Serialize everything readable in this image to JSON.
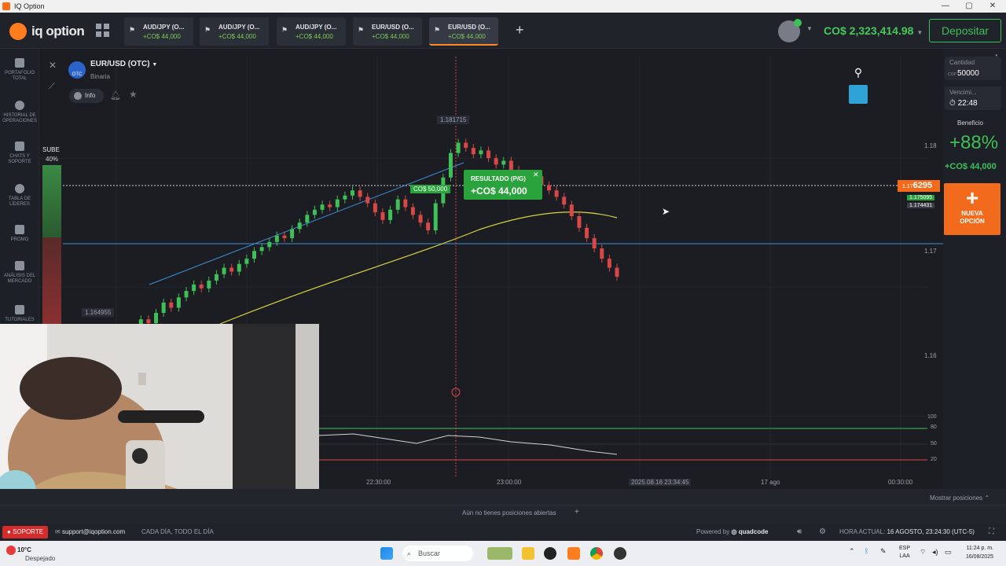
{
  "window": {
    "title": "IQ Option"
  },
  "brand": {
    "name": "iq option"
  },
  "tabs": [
    {
      "name": "AUD/JPY (O...",
      "profit": "+CO$ 44,000"
    },
    {
      "name": "AUD/JPY (O...",
      "profit": "+CO$ 44,000"
    },
    {
      "name": "AUD/JPY (O...",
      "profit": "+CO$ 44,000"
    },
    {
      "name": "EUR/USD (O...",
      "profit": "+CO$ 44,000"
    },
    {
      "name": "EUR/USD (O...",
      "profit": "+CO$ 44,000"
    }
  ],
  "account": {
    "balance": "CO$ 2,323,414.98",
    "deposit_label": "Depositar"
  },
  "nav": [
    {
      "label": "PORTAFOLIO TOTAL"
    },
    {
      "label": "HISTORIAL DE OPERACIONES"
    },
    {
      "label": "CHATS Y SOPORTE"
    },
    {
      "label": "TABLA DE LÍDERES"
    },
    {
      "label": "PROMO"
    },
    {
      "label": "ANÁLISIS DEL MERCADO"
    },
    {
      "label": "TUTORIALES"
    }
  ],
  "asset": {
    "name": "EUR/USD (OTC)",
    "type": "Binaria",
    "info_label": "Info",
    "badge": "OTC"
  },
  "sentiment": {
    "label": "SUBE",
    "value": "40%"
  },
  "chart_labels": {
    "top_price": "1.181715",
    "low_price": "1.164955",
    "current_price_prefix": "1.17",
    "current_price_big": "6295",
    "price_a": "1.175095",
    "price_b": "1.174431",
    "invest_tag": "CO$ 50,000",
    "result_title": "RESULTADO (P/G)",
    "result_value": "+CO$ 44,000",
    "y_ticks": [
      "1.18",
      "1.17",
      "1.16"
    ],
    "osc_ticks": [
      "100",
      "80",
      "50",
      "20"
    ],
    "x_ticks": [
      "22:30:00",
      "23:00:00",
      "2025.08.16 23:34:45",
      "17 ago",
      "00:30:00"
    ]
  },
  "right_panel": {
    "amount_label": "Cantidad",
    "amount_value": "50000",
    "amount_currency": "COP",
    "expiry_label": "Vencimi...",
    "expiry_value": "22:48",
    "profit_label": "Beneficio",
    "profit_pct": "+88%",
    "profit_value": "+CO$ 44,000",
    "new_option": "NUEVA OPCIÓN"
  },
  "positions": {
    "empty_text": "Aún no tienes posiciones abiertas",
    "show_label": "Mostrar posiciones"
  },
  "footer": {
    "support": "SOPORTE",
    "email": "support@iqoption.com",
    "hours": "CADA DÍA, TODO EL DÍA",
    "powered": "Powered by",
    "provider": "quadcode",
    "time_label": "HORA ACTUAL:",
    "time_value": "16 AGOSTO, 23:24:30 (UTC-5)"
  },
  "taskbar": {
    "weather_temp": "10°C",
    "weather_desc": "Despejado",
    "search": "Buscar",
    "lang": "ESP",
    "region": "LAA",
    "clock_time": "11:24 p. m.",
    "clock_date": "16/08/2025"
  },
  "colors": {
    "up": "#3fbf58",
    "down": "#d84848",
    "accent": "#ff7d1e",
    "ma": "#d8d444",
    "trend": "#3d8fd6"
  },
  "chart_data": {
    "type": "candlestick",
    "x_ticks": [
      "22:30:00",
      "23:00:00",
      "17 ago",
      "00:30:00"
    ],
    "y_ticks": [
      1.16,
      1.17,
      1.18
    ],
    "ylim": [
      1.158,
      1.183
    ],
    "candles_close": [
      1.1635,
      1.1641,
      1.1648,
      1.1652,
      1.1658,
      1.1663,
      1.1668,
      1.1675,
      1.1672,
      1.168,
      1.1688,
      1.1684,
      1.1692,
      1.1697,
      1.1702,
      1.1699,
      1.1705,
      1.171,
      1.1715,
      1.1712,
      1.1718,
      1.1722,
      1.1728,
      1.1731,
      1.1735,
      1.174,
      1.1738,
      1.1745,
      1.175,
      1.1756,
      1.176,
      1.1764,
      1.1762,
      1.1768,
      1.1771,
      1.1775,
      1.177,
      1.1765,
      1.1758,
      1.1752,
      1.176,
      1.1768,
      1.1762,
      1.1756,
      1.175,
      1.1744,
      1.1765,
      1.1785,
      1.1804,
      1.1812,
      1.1808,
      1.1803,
      1.1806,
      1.18,
      1.1795,
      1.1798,
      1.1791,
      1.1788,
      1.1782,
      1.1786,
      1.1779,
      1.1775,
      1.177,
      1.1764,
      1.1755,
      1.1746,
      1.1738,
      1.173,
      1.1722,
      1.1715,
      1.1708
    ]
  }
}
